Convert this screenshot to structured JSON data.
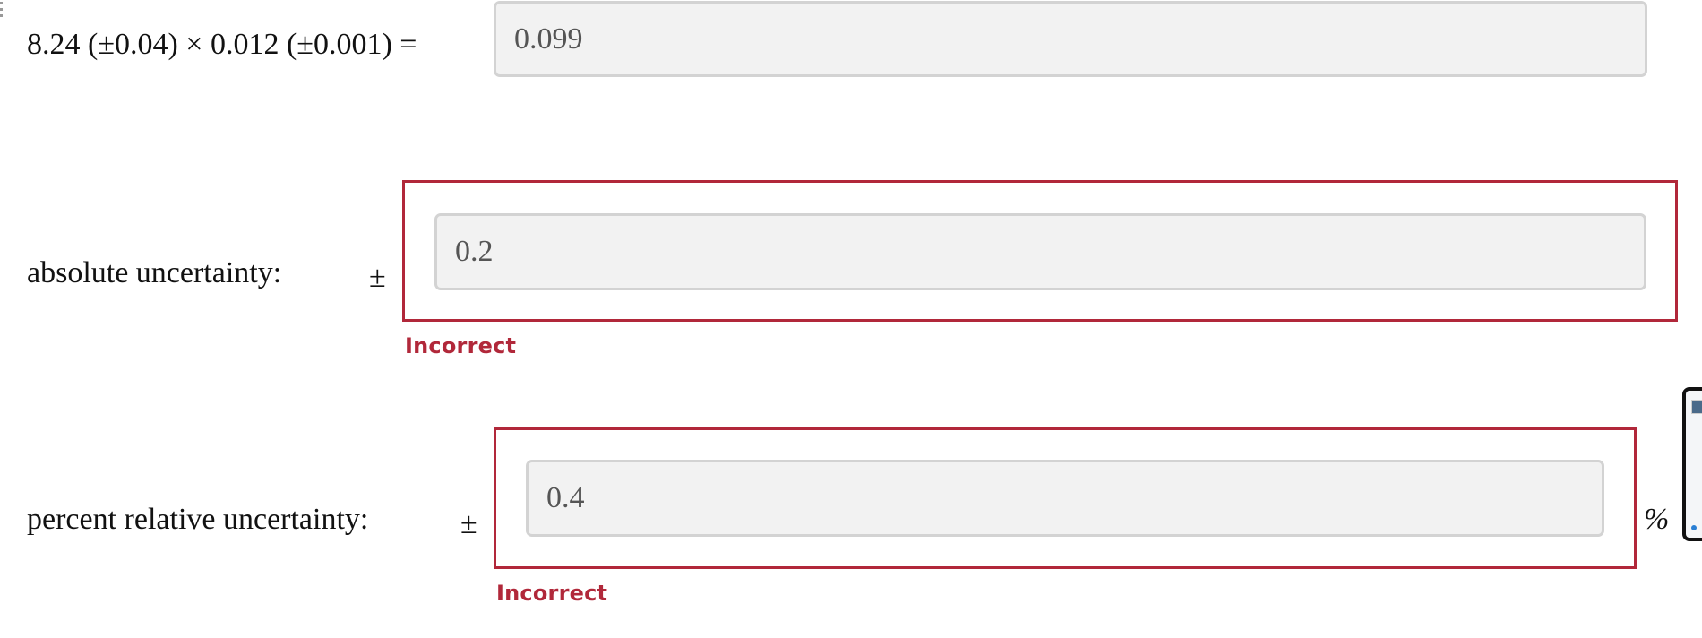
{
  "equation": {
    "expression": "8.24 (±0.04) × 0.012 (±0.001) =",
    "answer_value": "0.099"
  },
  "absolute": {
    "label": "absolute uncertainty:",
    "pm_symbol": "±",
    "value": "0.2",
    "feedback": "Incorrect"
  },
  "percent": {
    "label": "percent relative uncertainty:",
    "pm_symbol": "±",
    "value": "0.4",
    "unit": "%",
    "feedback": "Incorrect"
  },
  "colors": {
    "error": "#b1283a",
    "input_bg": "#f2f2f2",
    "input_border": "#d3d3d3"
  }
}
